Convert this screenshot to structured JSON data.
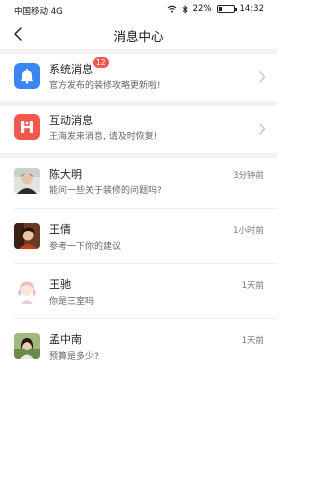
{
  "status_bar": {
    "carrier": "中国移动 4G",
    "battery": "22%",
    "battery_level": 0.22,
    "time": "14:32"
  },
  "header": {
    "title": "消息中心"
  },
  "system_rows": [
    {
      "title": "系统消息",
      "subtitle": "官方发布的装修攻略更新啦!",
      "badge": "12",
      "icon": "bell-icon",
      "color": "#3a86f3"
    },
    {
      "title": "互动消息",
      "subtitle": "王海发来消息, 请及时恢复!",
      "icon": "interaction-icon",
      "color": "#f2584f"
    }
  ],
  "conversations": [
    {
      "name": "陈大明",
      "preview": "能问一些关于装修的问题吗?",
      "time": "3分钟前"
    },
    {
      "name": "王倩",
      "preview": "参考一下你的建议",
      "time": "1小时前"
    },
    {
      "name": "王驰",
      "preview": "你是三室吗",
      "time": "1天前"
    },
    {
      "name": "孟中南",
      "preview": "预算是多少?",
      "time": "1天前"
    }
  ]
}
